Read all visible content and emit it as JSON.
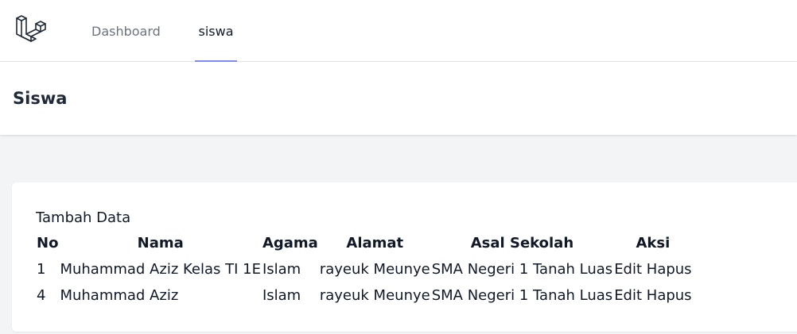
{
  "nav": {
    "logo_icon": "laravel-logo-icon",
    "links": [
      {
        "label": "Dashboard",
        "active": false
      },
      {
        "label": "siswa",
        "active": true
      }
    ],
    "active_underline_color": "#818cf8"
  },
  "header": {
    "title": "Siswa"
  },
  "main": {
    "add_link": "Tambah Data",
    "table": {
      "columns": [
        "No",
        "Nama",
        "Agama",
        "Alamat",
        "Asal Sekolah",
        "Aksi"
      ],
      "rows": [
        {
          "no": "1",
          "nama": "Muhammad Aziz Kelas TI 1E",
          "agama": "Islam",
          "alamat": "rayeuk Meunye",
          "asal_sekolah": "SMA Negeri 1 Tanah Luas",
          "edit": "Edit",
          "hapus": "Hapus"
        },
        {
          "no": "4",
          "nama": "Muhammad Aziz",
          "agama": "Islam",
          "alamat": "rayeuk Meunye",
          "asal_sekolah": "SMA Negeri 1 Tanah Luas",
          "edit": "Edit",
          "hapus": "Hapus"
        }
      ]
    }
  }
}
